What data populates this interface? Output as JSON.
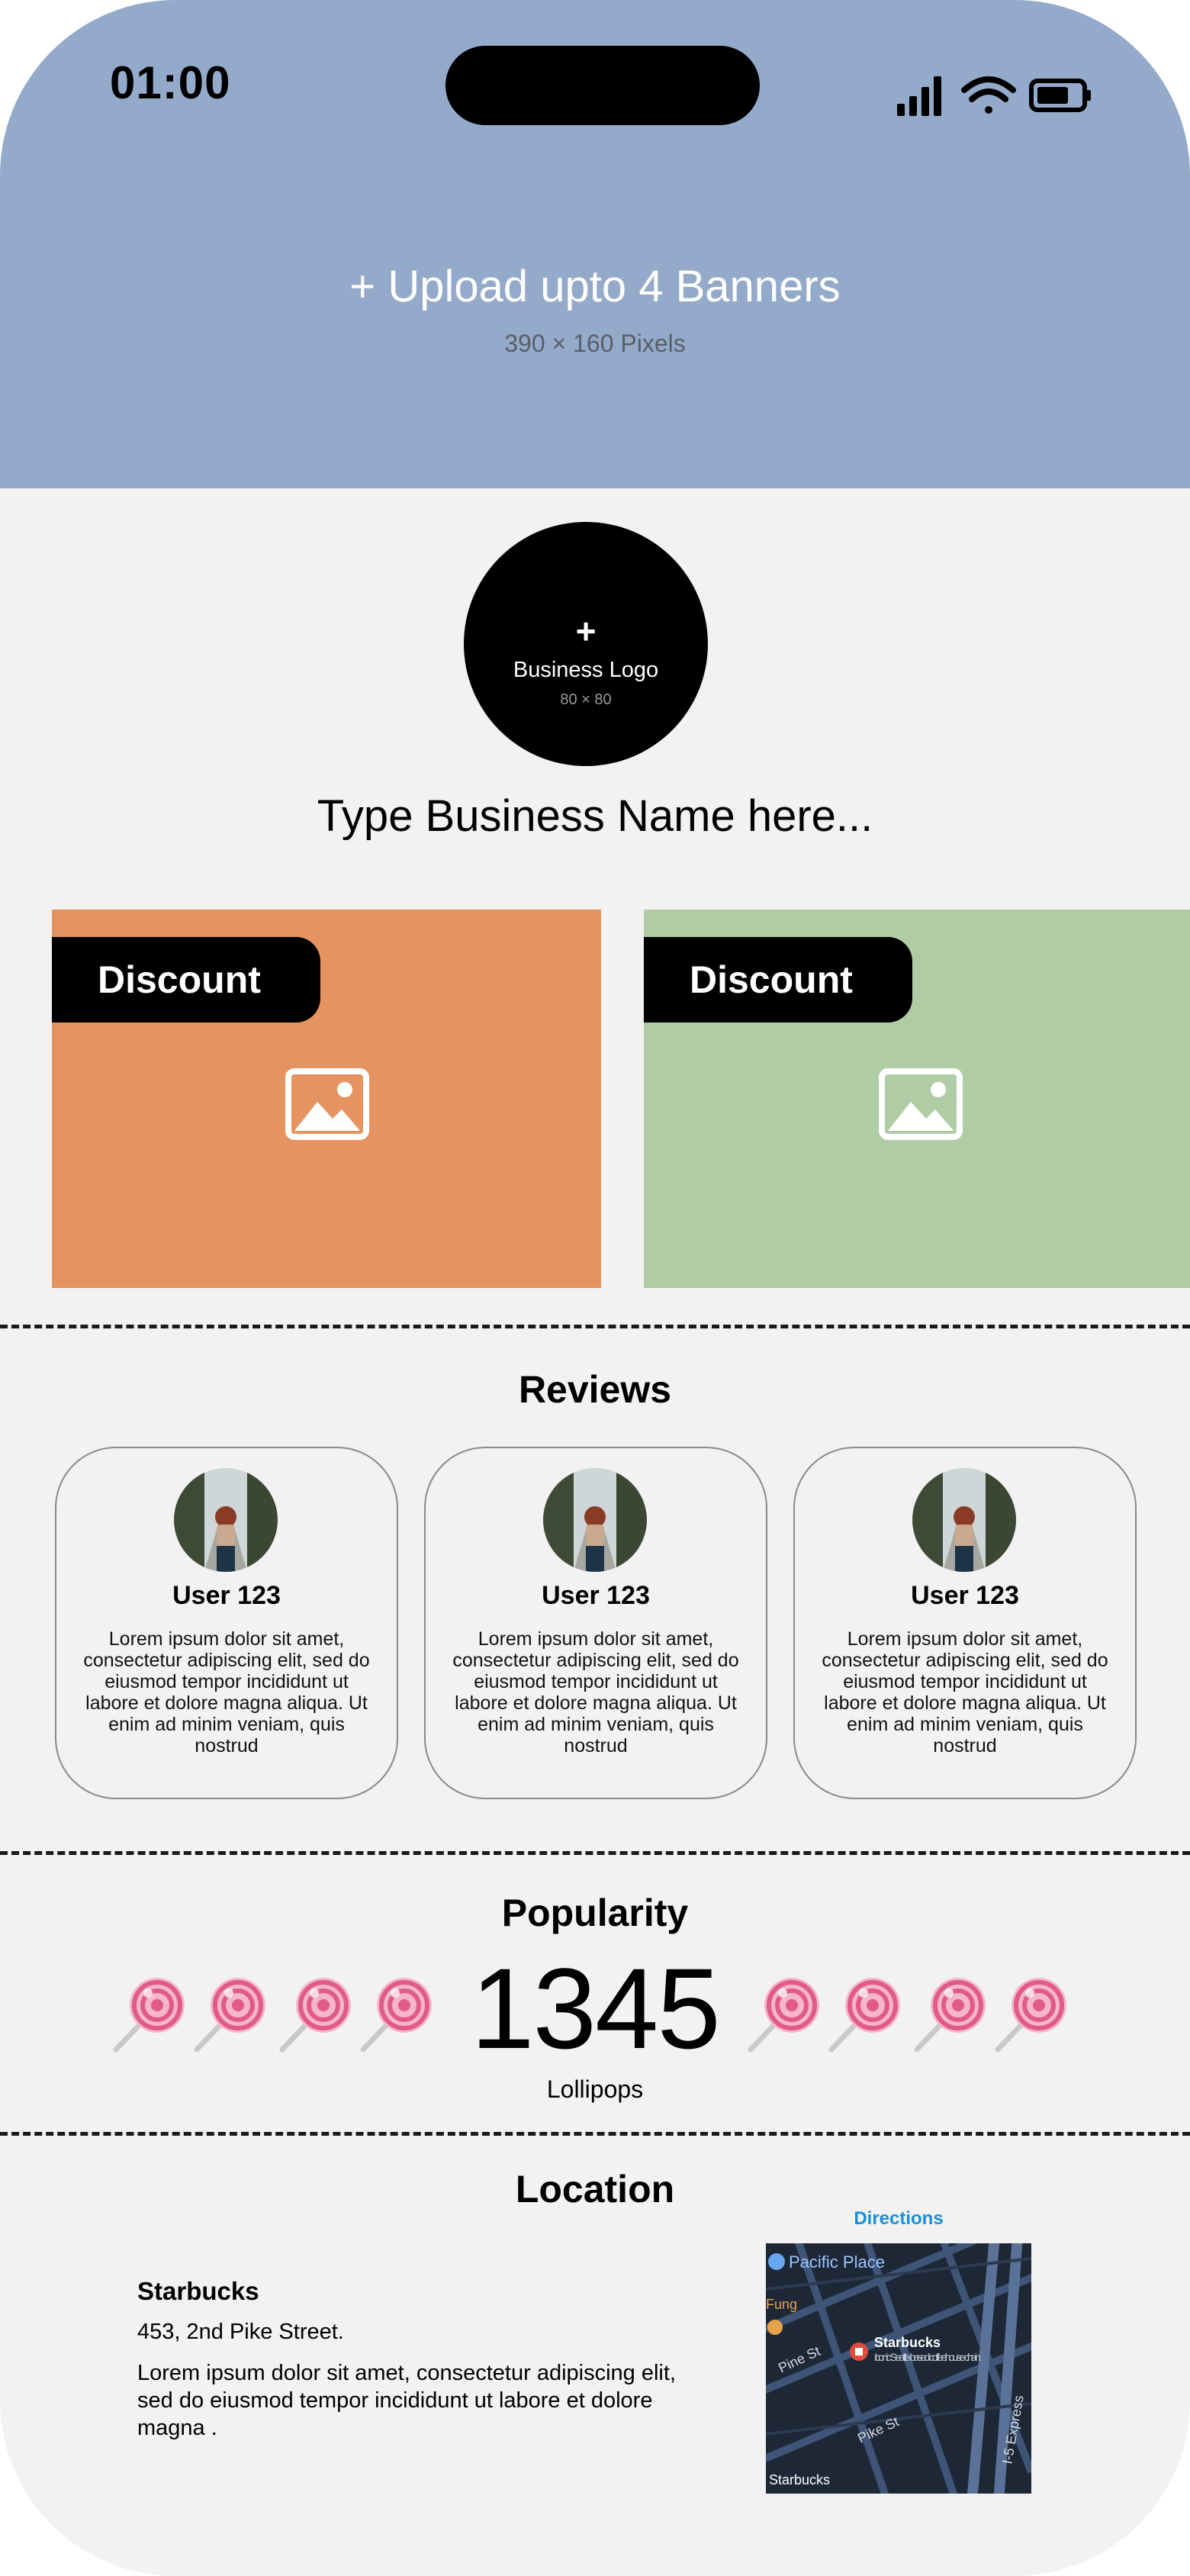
{
  "status_bar": {
    "time": "01:00"
  },
  "banner": {
    "title": "+ Upload upto 4 Banners",
    "subtitle": "390 × 160 Pixels"
  },
  "logo": {
    "plus": "+",
    "label": "Business Logo",
    "dimensions": "80 × 80"
  },
  "business_name_placeholder": "Type Business Name here...",
  "discounts": [
    {
      "label": "Discount",
      "color": "#e59361"
    },
    {
      "label": "Discount",
      "color": "#afcca4"
    }
  ],
  "reviews": {
    "title": "Reviews",
    "items": [
      {
        "user": "User 123",
        "text": "Lorem ipsum dolor sit amet, consectetur adipiscing elit, sed do eiusmod tempor incididunt ut labore et dolore magna aliqua. Ut enim ad minim veniam, quis nostrud"
      },
      {
        "user": "User 123",
        "text": "Lorem ipsum dolor sit amet, consectetur adipiscing elit, sed do eiusmod tempor incididunt ut labore et dolore magna aliqua. Ut enim ad minim veniam, quis nostrud"
      },
      {
        "user": "User 123",
        "text": "Lorem ipsum dolor sit amet, consectetur adipiscing elit, sed do eiusmod tempor incididunt ut labore et dolore magna aliqua. Ut enim ad minim veniam, quis nostrud"
      }
    ]
  },
  "popularity": {
    "title": "Popularity",
    "count": "1345",
    "unit": "Lollipops",
    "icon": "lollipop-icon"
  },
  "location": {
    "title": "Location",
    "name": "Starbucks",
    "address": "453, 2nd Pike Street.",
    "description": "Lorem ipsum dolor sit amet, consectetur adipiscing elit, sed do eiusmod tempor incididunt ut labore et dolore magna .",
    "directions_label": "Directions",
    "map": {
      "place_top": "Pacific Place",
      "place_left": "Fung",
      "street_1": "Pine St",
      "street_2": "Pike St",
      "highway": "I-5 Express",
      "pin_title": "Starbucks",
      "pin_sub": "Iconic Seattle-based coffeehouse chain",
      "corner_label": "Starbucks"
    }
  },
  "colors": {
    "banner": "#94aacb",
    "background": "#f2f2f2",
    "accent_link": "#1a8fd6"
  }
}
